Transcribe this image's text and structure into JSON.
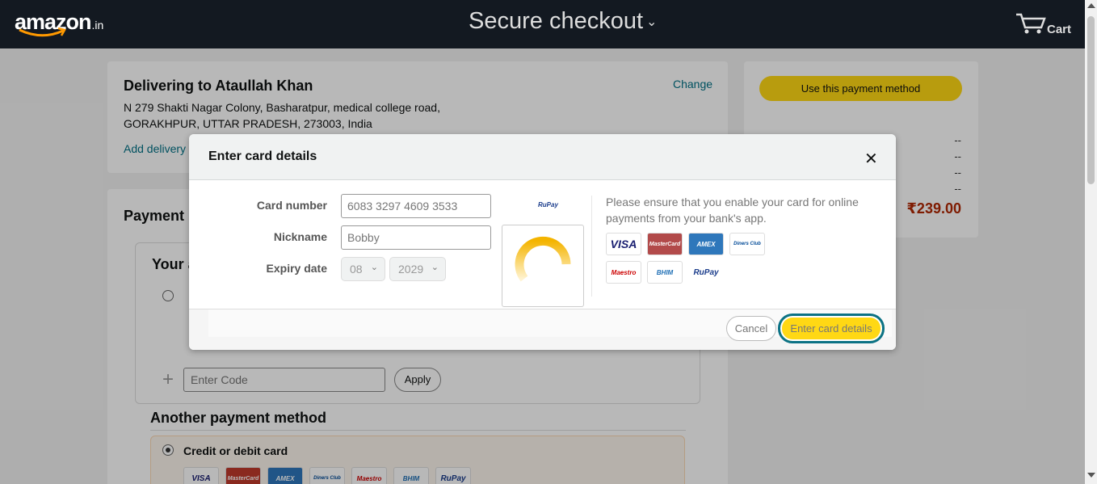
{
  "header": {
    "logo": "amazon",
    "logo_tld": ".in",
    "title": "Secure checkout",
    "cart_label": "Cart"
  },
  "delivery": {
    "title": "Delivering to Ataullah Khan",
    "address_line1": "N 279 Shakti Nagar Colony, Basharatpur, medical college road,",
    "address_line2": "GORAKHPUR, UTTAR PRADESH, 273003, India",
    "change_label": "Change",
    "add_instructions": "Add delivery"
  },
  "summary": {
    "use_payment_label": "Use this payment method",
    "dash": "--",
    "total": "₹239.00"
  },
  "payment": {
    "title": "Payment m",
    "your_account_title": "Your a",
    "code_placeholder": "Enter Code",
    "apply_label": "Apply",
    "another_title": "Another payment method",
    "credit_debit_label": "Credit or debit card",
    "card_logos": [
      "VISA",
      "MasterCard",
      "AMEX",
      "Diners Club",
      "Maestro",
      "BHIM",
      "RuPay"
    ]
  },
  "modal": {
    "title": "Enter card details",
    "card_number_label": "Card number",
    "card_number_value": "6083 3297 4609 3533",
    "nickname_label": "Nickname",
    "nickname_value": "Bobby",
    "expiry_label": "Expiry date",
    "expiry_month": "08",
    "expiry_year": "2029",
    "detected_network": "RuPay",
    "notice": "Please ensure that you enable your card for online payments from your bank's app.",
    "accepted_logos": [
      "VISA",
      "MasterCard",
      "AMEX",
      "Diners Club",
      "Maestro",
      "BHIM",
      "RuPay"
    ],
    "cancel_label": "Cancel",
    "submit_label": "Enter card details"
  },
  "colors": {
    "header_bg": "#131921",
    "button_yellow": "#ffd814",
    "link": "#007185",
    "focus_ring": "#0b7285",
    "spinner": "#f4b400"
  }
}
